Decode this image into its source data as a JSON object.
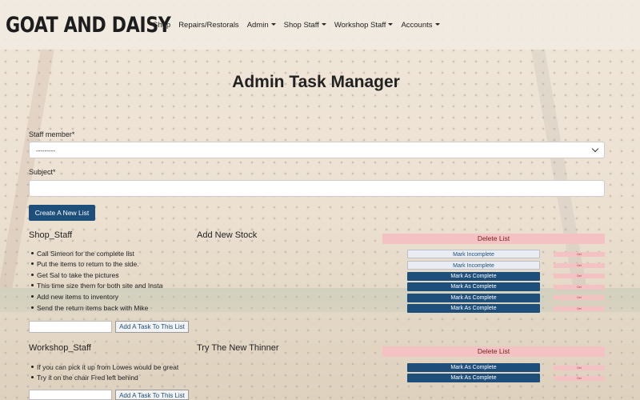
{
  "brand": "GOAT AND DAISY",
  "nav": [
    {
      "label": "Shop"
    },
    {
      "label": "Repairs/Restorals"
    },
    {
      "label": "Admin"
    },
    {
      "label": "Shop Staff"
    },
    {
      "label": "Workshop Staff"
    },
    {
      "label": "Accounts"
    }
  ],
  "page_title": "Admin Task Manager",
  "form": {
    "staff_label": "Staff member*",
    "staff_value": "---------",
    "subject_label": "Subject*",
    "subject_value": "",
    "create_button": "Create A New List"
  },
  "lists": [
    {
      "staff": "Shop_Staff",
      "title": "Add New Stock",
      "delete_label": "Delete List",
      "tasks": [
        {
          "text": "Call Simeon for the complete list",
          "action": "Mark Incomplete",
          "del": "Del"
        },
        {
          "text": "Put the items to return to the side.",
          "action": "Mark Incomplete",
          "del": "Del"
        },
        {
          "text": "Get Sal to take the pictures",
          "action": "Mark As Complete",
          "del": "Del"
        },
        {
          "text": "This time size them for both site and Insta",
          "action": "Mark As Complete",
          "del": "Del"
        },
        {
          "text": "Add new items to inventory",
          "action": "Mark As Complete",
          "del": "Del"
        },
        {
          "text": "Send the return items back with Mike",
          "action": "Mark As Complete",
          "del": "Del"
        }
      ],
      "add_input": "",
      "add_button": "Add A Task To This List"
    },
    {
      "staff": "Workshop_Staff",
      "title": "Try The New Thinner",
      "delete_label": "Delete List",
      "tasks": [
        {
          "text": "If you can pick it up from Lowes would be great",
          "action": "Mark As Complete",
          "del": "Del"
        },
        {
          "text": "Try it on the chair Fred left behind",
          "action": "Mark As Complete",
          "del": "Del"
        }
      ],
      "add_input": "",
      "add_button": "Add A Task To This List"
    }
  ],
  "colors": {
    "primary": "#1e4f7a",
    "danger_light": "#f4c2c2"
  }
}
